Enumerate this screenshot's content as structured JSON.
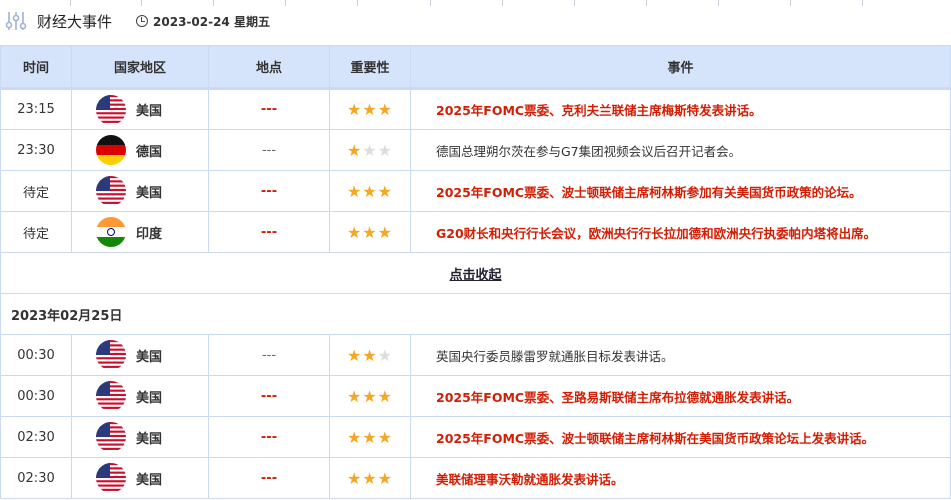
{
  "header": {
    "title": "财经大事件",
    "date": "2023-02-24 星期五"
  },
  "columns": [
    "时间",
    "国家地区",
    "地点",
    "重要性",
    "事件"
  ],
  "day1": [
    {
      "time": "23:15",
      "flag": "us",
      "country": "美国",
      "place": "---",
      "stars": 3,
      "event": "2025年FOMC票委、克利夫兰联储主席梅斯特发表讲话。",
      "important": true
    },
    {
      "time": "23:30",
      "flag": "de",
      "country": "德国",
      "place": "---",
      "stars": 1,
      "event": "德国总理朔尔茨在参与G7集团视频会议后召开记者会。",
      "important": false
    },
    {
      "time": "待定",
      "flag": "us",
      "country": "美国",
      "place": "---",
      "stars": 3,
      "event": "2025年FOMC票委、波士顿联储主席柯林斯参加有关美国货币政策的论坛。",
      "important": true
    },
    {
      "time": "待定",
      "flag": "in",
      "country": "印度",
      "place": "---",
      "stars": 3,
      "event": "G20财长和央行行长会议，欧洲央行行长拉加德和欧洲央行执委帕内塔将出席。",
      "important": true
    }
  ],
  "collapse_label": "点击收起",
  "day2_label": "2023年02月25日",
  "day2": [
    {
      "time": "00:30",
      "flag": "us",
      "country": "美国",
      "place": "---",
      "stars": 2,
      "event": "英国央行委员滕雷罗就通胀目标发表讲话。",
      "important": false
    },
    {
      "time": "00:30",
      "flag": "us",
      "country": "美国",
      "place": "---",
      "stars": 3,
      "event": "2025年FOMC票委、圣路易斯联储主席布拉德就通胀发表讲话。",
      "important": true
    },
    {
      "time": "02:30",
      "flag": "us",
      "country": "美国",
      "place": "---",
      "stars": 3,
      "event": "2025年FOMC票委、波士顿联储主席柯林斯在美国货币政策论坛上发表讲话。",
      "important": true
    },
    {
      "time": "02:30",
      "flag": "us",
      "country": "美国",
      "place": "---",
      "stars": 3,
      "event": "美联储理事沃勒就通胀发表讲话。",
      "important": true
    }
  ],
  "colors": {
    "accent": "#d21e05",
    "header_bg": "#d6e4fb",
    "star": "#f5a623"
  }
}
